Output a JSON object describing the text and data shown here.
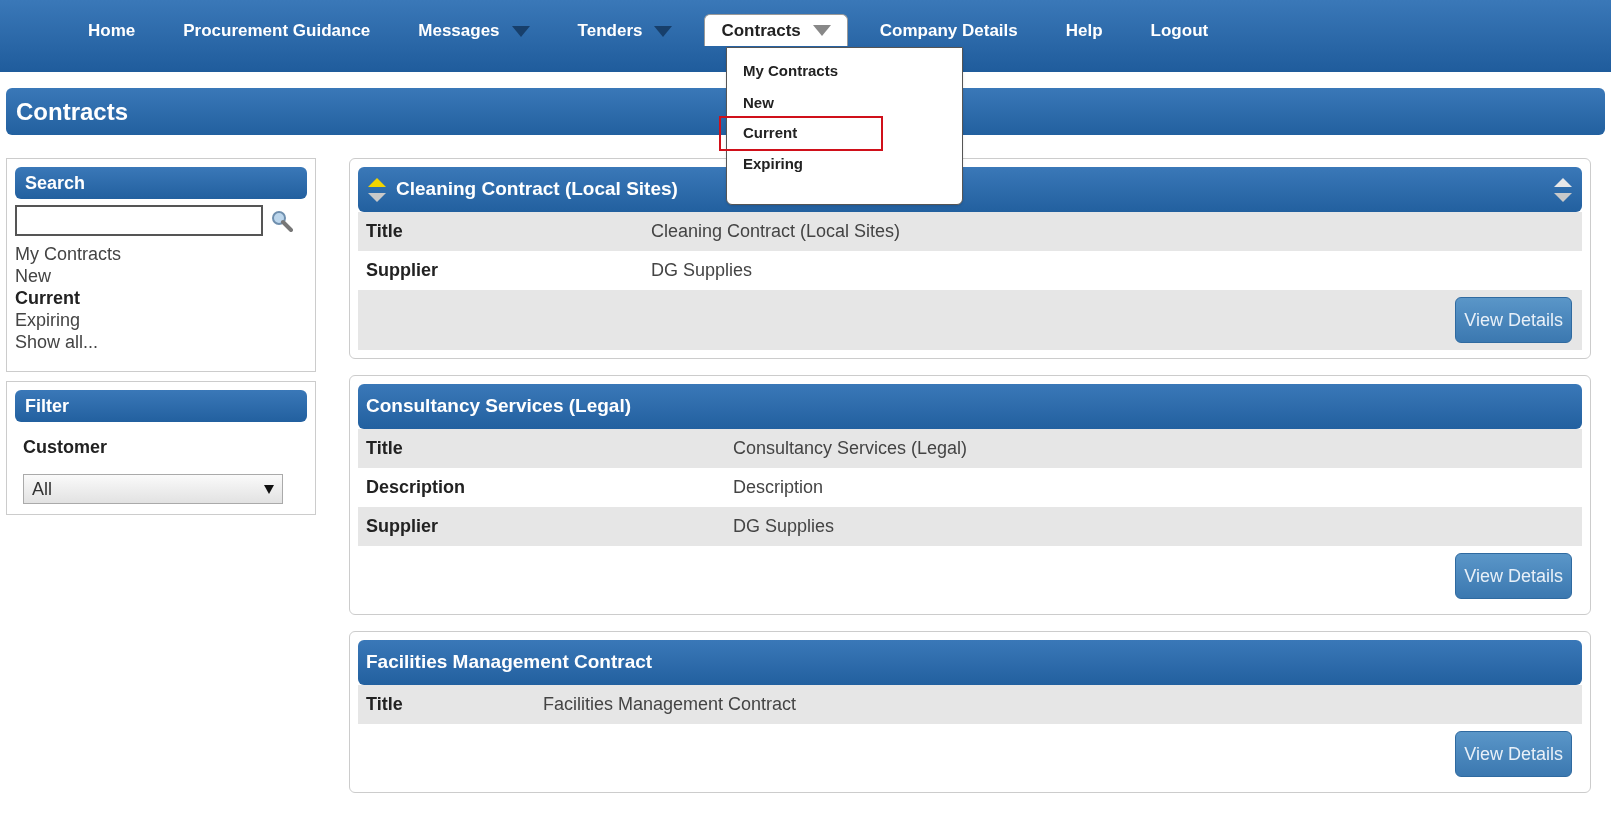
{
  "nav": {
    "items": [
      {
        "label": "Home",
        "dropdown": false,
        "open": false
      },
      {
        "label": "Procurement Guidance",
        "dropdown": false,
        "open": false
      },
      {
        "label": "Messages",
        "dropdown": true,
        "open": false
      },
      {
        "label": "Tenders",
        "dropdown": true,
        "open": false
      },
      {
        "label": "Contracts",
        "dropdown": true,
        "open": true
      },
      {
        "label": "Company Details",
        "dropdown": false,
        "open": false
      },
      {
        "label": "Help",
        "dropdown": false,
        "open": false
      },
      {
        "label": "Logout",
        "dropdown": false,
        "open": false
      }
    ]
  },
  "dropdown_menu": {
    "items": [
      {
        "label": "My Contracts",
        "highlighted": false
      },
      {
        "label": "New",
        "highlighted": false
      },
      {
        "label": "Current",
        "highlighted": true
      },
      {
        "label": "Expiring",
        "highlighted": false
      }
    ]
  },
  "page_title": "Contracts",
  "sidebar": {
    "search": {
      "title": "Search",
      "links": [
        {
          "label": "My Contracts",
          "selected": false
        },
        {
          "label": "New",
          "selected": false
        },
        {
          "label": "Current",
          "selected": true
        },
        {
          "label": "Expiring",
          "selected": false
        },
        {
          "label": "Show all...",
          "selected": false
        }
      ]
    },
    "filter": {
      "title": "Filter",
      "field_label": "Customer",
      "select_value": "All"
    }
  },
  "contracts": [
    {
      "heading": "Cleaning Contract (Local Sites)",
      "sortable": true,
      "fields": [
        {
          "label": "Title",
          "value": "Cleaning Contract (Local Sites)"
        },
        {
          "label": "Supplier",
          "value": "DG Supplies"
        }
      ],
      "button": "View Details"
    },
    {
      "heading": "Consultancy Services (Legal)",
      "sortable": false,
      "fields": [
        {
          "label": "Title",
          "value": "Consultancy Services (Legal)"
        },
        {
          "label": "Description",
          "value": "Description"
        },
        {
          "label": "Supplier",
          "value": "DG Supplies"
        }
      ],
      "button": "View Details"
    },
    {
      "heading": "Facilities Management Contract",
      "sortable": false,
      "fields": [
        {
          "label": "Title",
          "value": "Facilities Management Contract"
        }
      ],
      "button": "View Details"
    }
  ]
}
